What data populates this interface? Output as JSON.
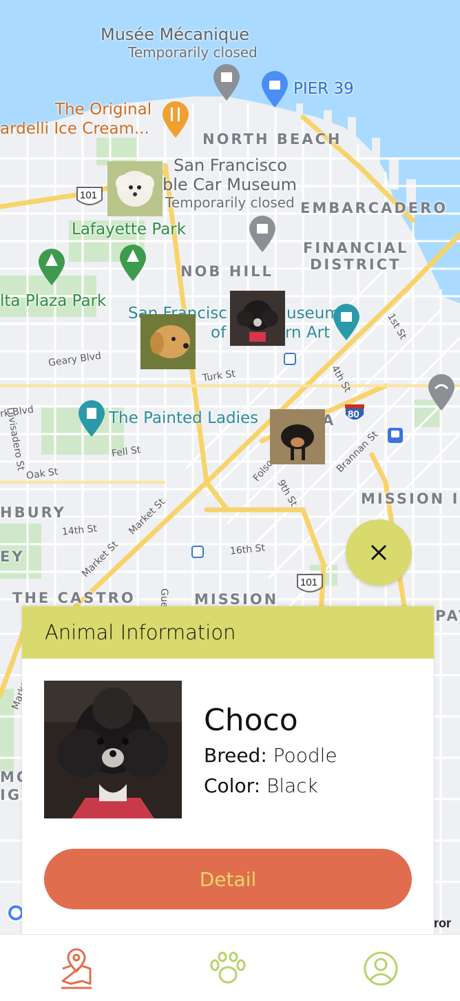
{
  "map": {
    "labels": {
      "musee": "Musée Mécanique",
      "musee_status": "Temporarily closed",
      "pier39": "PIER 39",
      "ghirardelli_1": "The Original",
      "ghirardelli_2": "ardelli Ice Cream...",
      "north_beach": "NORTH BEACH",
      "sf_car_museum_1": "San Francisco",
      "sf_car_museum_2": "ble Car Museum",
      "car_museum_status": "Temporarily closed",
      "embarcadero": "EMBARCADERO",
      "lafayette_park": "Lafayette Park",
      "financial_1": "FINANCIAL",
      "financial_2": "DISTRICT",
      "nob_hill": "NOB HILL",
      "alta_plaza": "lta Plaza Park",
      "sfmoma_1": "San Francisc",
      "sfmoma_1b": "useum",
      "sfmoma_2": "of",
      "sfmoma_2b": "rn Art",
      "painted_ladies": "The Painted Ladies",
      "mission_bay": "MISSION I",
      "haight": "HBURY",
      "castro": "THE CASTRO",
      "mission": "MISSION",
      "ey": "EY",
      "pat": "PAT",
      "mo": "MO",
      "igh": "IGH",
      "a": "A"
    },
    "streets": {
      "geary": "Geary Blvd",
      "turk": "Turk St",
      "divisadero": "Divisadero St",
      "rk_blvd": "rk Blvd",
      "fell": "Fell St",
      "oak": "Oak St",
      "market1": "Market St",
      "market2": "Market St",
      "market3": "Market St",
      "fourteenth": "14th St",
      "sixteenth": "16th St",
      "ninth": "9th St",
      "fourth": "4th St",
      "first": "1st St",
      "brannan": "Brannan St",
      "folsom": "Folsom",
      "guerrero": "Guer"
    },
    "shields": {
      "us101_a": "101",
      "us101_b": "101",
      "i80": "80"
    },
    "attribution_fragment": "ror"
  },
  "info_card": {
    "header": "Animal Information",
    "name": "Choco",
    "breed_label": "Breed:",
    "breed_value": "Poodle",
    "color_label": "Color:",
    "color_value": "Black",
    "detail_button": "Detail"
  },
  "close_button": {
    "icon": "close-icon"
  },
  "bottom_nav": {
    "items": [
      {
        "name": "map",
        "icon": "map-pin-icon",
        "active": true
      },
      {
        "name": "pets",
        "icon": "paw-icon",
        "active": false
      },
      {
        "name": "profile",
        "icon": "user-circle-icon",
        "active": false
      }
    ]
  },
  "colors": {
    "accent_yellow": "#d8da6e",
    "button_orange": "#e06e4e",
    "button_text": "#e8d66a",
    "nav_active": "#e06e4e",
    "nav_inactive": "#b6d36c",
    "water": "#aadaff"
  }
}
